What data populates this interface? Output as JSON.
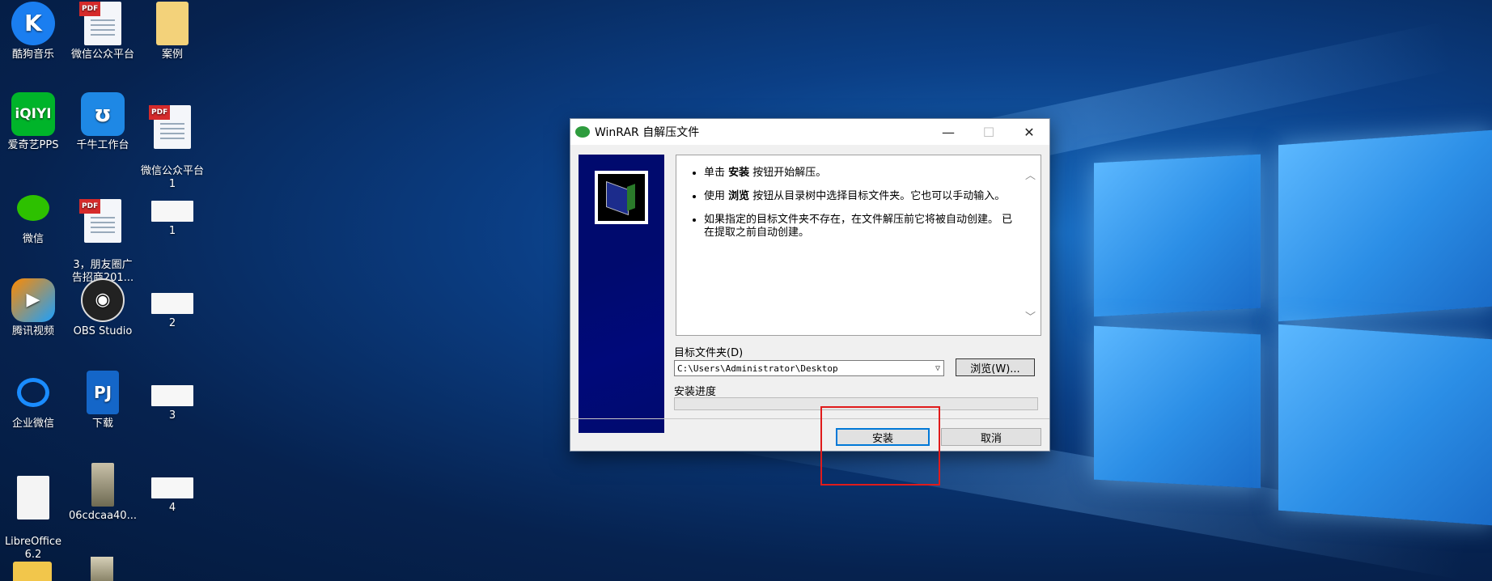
{
  "desktop": {
    "icons": [
      {
        "label": "酷狗音乐",
        "icon": "kugou-icon"
      },
      {
        "label": "微信公众平台",
        "icon": "pdf-document-icon",
        "badge": "PDF"
      },
      {
        "label": "案例",
        "icon": "folder-icon"
      },
      {
        "label": "爱奇艺PPS",
        "icon": "iqiyi-icon"
      },
      {
        "label": "千牛工作台",
        "icon": "qianniu-icon"
      },
      {
        "label": "微信公众平台\n1",
        "icon": "pdf-document-icon",
        "badge": "PDF"
      },
      {
        "label": "微信",
        "icon": "wechat-icon"
      },
      {
        "label": "3，朋友圈广\n告招商201...",
        "icon": "pdf-document-icon",
        "badge": "PDF"
      },
      {
        "label": "1",
        "icon": "image-thumbnail-icon"
      },
      {
        "label": "腾讯视频",
        "icon": "tencent-video-icon"
      },
      {
        "label": "OBS Studio",
        "icon": "obs-icon"
      },
      {
        "label": "2",
        "icon": "image-thumbnail-icon"
      },
      {
        "label": "企业微信",
        "icon": "wecom-icon"
      },
      {
        "label": "下载",
        "icon": "download-app-icon"
      },
      {
        "label": "3",
        "icon": "image-thumbnail-icon"
      },
      {
        "label": "LibreOffice\n6.2",
        "icon": "libreoffice-icon"
      },
      {
        "label": "06cdcaa40...",
        "icon": "video-thumbnail-icon"
      },
      {
        "label": "4",
        "icon": "image-thumbnail-icon"
      }
    ]
  },
  "dialog": {
    "title": "WinRAR 自解压文件",
    "info": [
      {
        "pre": "单击 ",
        "bold": "安装",
        "post": " 按钮开始解压。"
      },
      {
        "pre": "使用 ",
        "bold": "浏览",
        "post": " 按钮从目录树中选择目标文件夹。它也可以手动输入。"
      },
      {
        "pre": "如果指定的目标文件夹不存在，在文件解压前它将被自动创建。 已在提取之前自动创建。",
        "bold": "",
        "post": ""
      }
    ],
    "dest_label": "目标文件夹(D)",
    "dest_path": "C:\\Users\\Administrator\\Desktop",
    "browse_label": "浏览(W)...",
    "progress_label": "安装进度",
    "progress": 0,
    "install_label": "安装",
    "cancel_label": "取消"
  },
  "colors": {
    "highlight": "#e01b1b",
    "accent": "#0078d7"
  }
}
